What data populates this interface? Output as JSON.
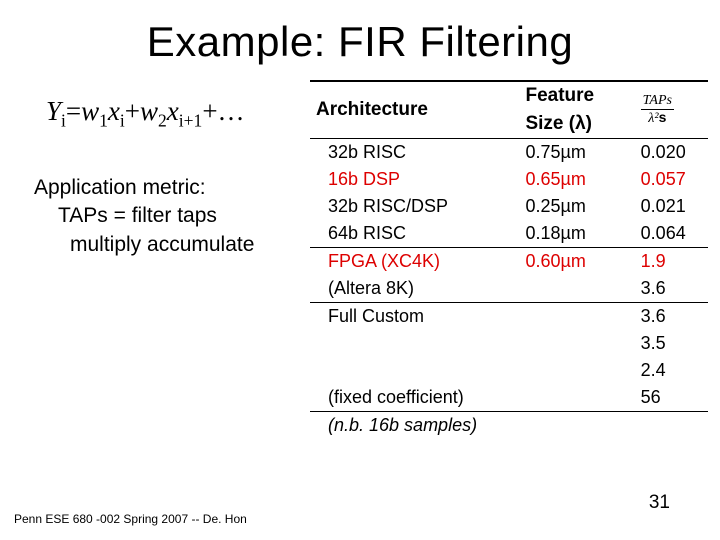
{
  "title": "Example: FIR Filtering",
  "equation": {
    "Y": "Y",
    "Ysub": "i",
    "eq": "=",
    "w1": "w",
    "w1sub": "1",
    "x1": "x",
    "x1sub": "i",
    "plus1": "+",
    "w2": "w",
    "w2sub": "2",
    "x2": "x",
    "x2sub": "i+1",
    "tail": "+…"
  },
  "metric": {
    "line1": "Application metric:",
    "line2": "TAPs = filter taps",
    "line3": "multiply accumulate"
  },
  "table": {
    "headers": {
      "arch": "Architecture",
      "fs_top": "Feature",
      "fs_bot": "Size (λ)",
      "taps_num": "TAPs",
      "taps_den": "λ²",
      "taps_s": "s"
    },
    "rows": [
      {
        "arch": "32b RISC",
        "fs": "0.75µm",
        "taps": "0.020",
        "red": false,
        "rule": "thin"
      },
      {
        "arch": "16b DSP",
        "fs": "0.65µm",
        "taps": "0.057",
        "red": true,
        "rule": ""
      },
      {
        "arch": "32b RISC/DSP",
        "fs": "0.25µm",
        "taps": "0.021",
        "red": false,
        "rule": ""
      },
      {
        "arch": "64b RISC",
        "fs": "0.18µm",
        "taps": "0.064",
        "red": false,
        "rule": ""
      },
      {
        "arch": "FPGA (XC4K)",
        "fs": "0.60µm",
        "taps": "1.9",
        "red": true,
        "rule": "thin"
      },
      {
        "arch": "(Altera 8K)",
        "fs": "",
        "taps": "3.6",
        "red": false,
        "rule": ""
      },
      {
        "arch": "Full Custom",
        "fs": "",
        "taps": "3.6",
        "red": false,
        "rule": "thin"
      },
      {
        "arch": "",
        "fs": "",
        "taps": "3.5",
        "red": false,
        "rule": ""
      },
      {
        "arch": "",
        "fs": "",
        "taps": "2.4",
        "red": false,
        "rule": ""
      },
      {
        "arch": "(fixed coefficient)",
        "fs": "",
        "taps": "56",
        "red": false,
        "rule": ""
      }
    ],
    "note": "(n.b. 16b samples)"
  },
  "footer": "Penn ESE 680 -002 Spring 2007 -- De. Hon",
  "pagenum": "31",
  "chart_data": {
    "type": "table",
    "title": "FIR Filtering throughput by architecture",
    "columns": [
      "Architecture",
      "Feature Size (λ)",
      "TAPs / (λ² · s)"
    ],
    "rows": [
      [
        "32b RISC",
        "0.75µm",
        0.02
      ],
      [
        "16b DSP",
        "0.65µm",
        0.057
      ],
      [
        "32b RISC/DSP",
        "0.25µm",
        0.021
      ],
      [
        "64b RISC",
        "0.18µm",
        0.064
      ],
      [
        "FPGA (XC4K)",
        "0.60µm",
        1.9
      ],
      [
        "(Altera 8K)",
        "",
        3.6
      ],
      [
        "Full Custom",
        "",
        3.6
      ],
      [
        "",
        "",
        3.5
      ],
      [
        "",
        "",
        2.4
      ],
      [
        "(fixed coefficient)",
        "",
        56
      ]
    ],
    "note": "n.b. 16b samples"
  }
}
